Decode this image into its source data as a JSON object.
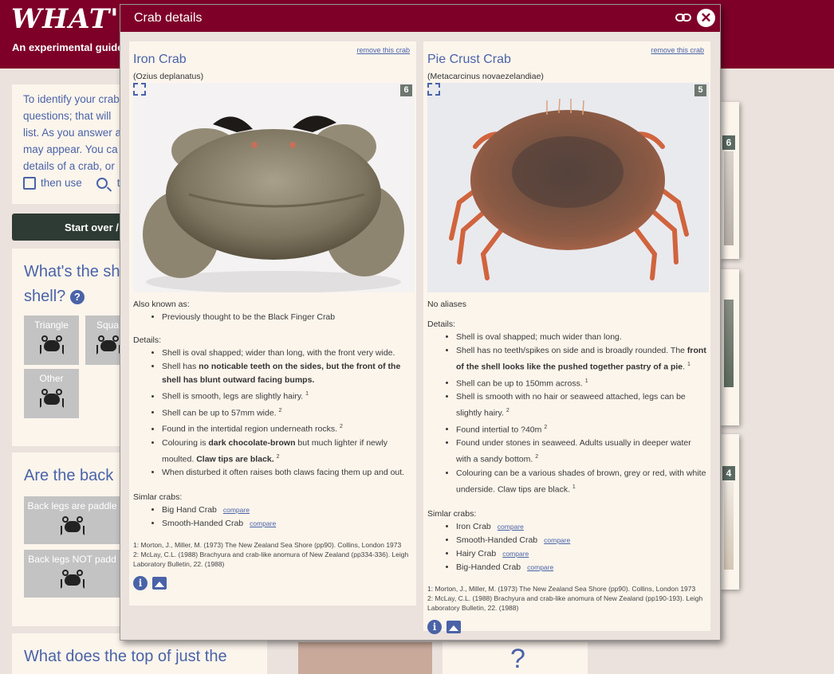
{
  "header": {
    "logo": "WHAT'S",
    "tagline": "An experimental guide"
  },
  "intro": {
    "lines": [
      "To identify your crab",
      "questions; that will",
      "list. As you answer a",
      "may appear. You ca",
      "details of a crab, or"
    ],
    "then_use": "then use",
    "to": "to"
  },
  "start_over": "Start over /",
  "questions": [
    {
      "title_line1": "What's the sh",
      "title_line2": "shell?",
      "options": [
        "Triangle",
        "Squa",
        "Other"
      ]
    },
    {
      "title": "Are the back",
      "options": [
        "Back legs are paddle",
        "Back legs NOT padd"
      ]
    },
    {
      "title": "What does the top of just the"
    }
  ],
  "right_badges": [
    "6",
    "4"
  ],
  "bottom_qmark": "?",
  "modal": {
    "title": "Crab details",
    "close": "✕",
    "icons": [
      "link-icon",
      "close-icon"
    ],
    "cards": [
      {
        "remove": "remove this crab",
        "name": "Iron Crab",
        "scientific": "(Ozius deplanatus)",
        "photo_count": "6",
        "aka_label": "Also known as:",
        "aka": [
          "Previously thought to be the Black Finger Crab"
        ],
        "details_label": "Details:",
        "details": [
          {
            "pre": "Shell is oval shapped; wider than long, with the front very wide.",
            "bold": "",
            "post": "",
            "sup": ""
          },
          {
            "pre": "Shell has ",
            "bold": "no noticable teeth on the sides, but the front of the shell has blunt outward facing bumps.",
            "post": "",
            "sup": ""
          },
          {
            "pre": "Shell is smooth, legs are slightly hairy.",
            "bold": "",
            "post": "",
            "sup": "1"
          },
          {
            "pre": "Shell can be up to 57mm wide.",
            "bold": "",
            "post": "",
            "sup": "2"
          },
          {
            "pre": "Found in the intertidal region underneath rocks.",
            "bold": "",
            "post": "",
            "sup": "2"
          },
          {
            "pre": "Colouring is ",
            "bold": "dark chocolate-brown",
            "post": " but much lighter if newly moulted. ",
            "bold2": "Claw tips are black.",
            "sup": "2"
          },
          {
            "pre": "When disturbed it often raises both claws facing them up and out.",
            "bold": "",
            "post": "",
            "sup": ""
          }
        ],
        "similar_label": "Simlar crabs:",
        "similar": [
          {
            "name": "Big Hand Crab",
            "compare": "compare"
          },
          {
            "name": "Smooth-Handed Crab",
            "compare": "compare"
          }
        ],
        "refs": [
          "1: Morton, J., Miller, M. (1973) The New Zealand Sea Shore (pp90). Collins, London 1973",
          "2: McLay, C.L. (1988) Brachyura and crab-like anomura of New Zealand (pp334-336). Leigh Laboratory Bulletin, 22. (1988)"
        ]
      },
      {
        "remove": "remove this crab",
        "name": "Pie Crust Crab",
        "scientific": "(Metacarcinus novaezelandiae)",
        "photo_count": "5",
        "aka_label": "No aliases",
        "details_label": "Details:",
        "details": [
          {
            "pre": "Shell is oval shapped; much wider than long.",
            "bold": "",
            "post": "",
            "sup": ""
          },
          {
            "pre": "Shell has no teeth/spikes on side and is broadly rounded. The ",
            "bold": "front of the shell looks like the pushed together pastry of a pie",
            "post": ".",
            "sup": "1"
          },
          {
            "pre": "Shell can be up to 150mm across.",
            "bold": "",
            "post": "",
            "sup": "1"
          },
          {
            "pre": "Shell is smooth with no hair or seaweed attached, legs can be slightly hairy.",
            "bold": "",
            "post": "",
            "sup": "2"
          },
          {
            "pre": "Found intertial to ?40m",
            "bold": "",
            "post": "",
            "sup": "2"
          },
          {
            "pre": "Found under stones in seaweed. Adults usually in deeper water with a sandy bottom.",
            "bold": "",
            "post": "",
            "sup": "2"
          },
          {
            "pre": "Colouring can be a various shades of brown, grey or red, with white underside. Claw tips are black.",
            "bold": "",
            "post": "",
            "sup": "1"
          }
        ],
        "similar_label": "Simlar crabs:",
        "similar": [
          {
            "name": "Iron Crab",
            "compare": "compare"
          },
          {
            "name": "Smooth-Handed Crab",
            "compare": "compare"
          },
          {
            "name": "Hairy Crab",
            "compare": "compare"
          },
          {
            "name": "Big-Handed Crab",
            "compare": "compare"
          }
        ],
        "refs": [
          "1: Morton, J., Miller, M. (1973) The New Zealand Sea Shore (pp90). Collins, London 1973",
          "2: McLay, C.L. (1988) Brachyura and crab-like anomura of New Zealand (pp190-193). Leigh Laboratory Bulletin, 22. (1988)"
        ]
      }
    ]
  },
  "colors": {
    "brand": "#7e0029",
    "accent": "#4a63a8",
    "panel": "#fcf5ec",
    "background": "#ebe2dd"
  }
}
